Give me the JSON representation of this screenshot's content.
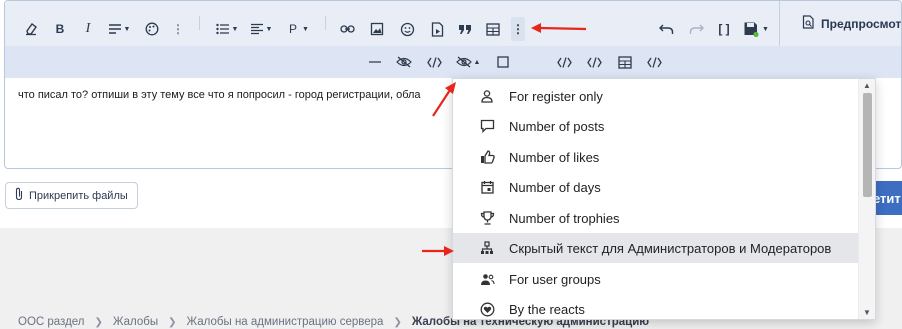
{
  "editor": {
    "content_text": "что писал то? отпиши в эту тему все что я попросил - город регистрации, обла"
  },
  "toolbar": {
    "format_label": "P",
    "preview_label": "Предпросмотр"
  },
  "attach": {
    "label": "Прикрепить файлы"
  },
  "reply_button": {
    "label": "етит"
  },
  "dropdown": {
    "items": [
      {
        "label": "For register only",
        "icon": "person-icon"
      },
      {
        "label": "Number of posts",
        "icon": "comment-icon"
      },
      {
        "label": "Number of likes",
        "icon": "thumbs-up-icon"
      },
      {
        "label": "Number of days",
        "icon": "calendar-icon"
      },
      {
        "label": "Number of trophies",
        "icon": "trophy-icon"
      },
      {
        "label": "Скрытый текст для Администраторов и Модераторов",
        "icon": "sitemap-icon"
      },
      {
        "label": "For user groups",
        "icon": "users-icon"
      },
      {
        "label": "By the reacts",
        "icon": "heart-icon"
      }
    ]
  },
  "breadcrumb": {
    "items": [
      "ООС раздел",
      "Жалобы",
      "Жалобы на администрацию сервера"
    ],
    "current": "Жалобы на техническую администрацию"
  },
  "colors": {
    "toolbar_bg": "#e8edf6",
    "accent": "#3d6ec2",
    "annotation_red": "#e8261b"
  }
}
